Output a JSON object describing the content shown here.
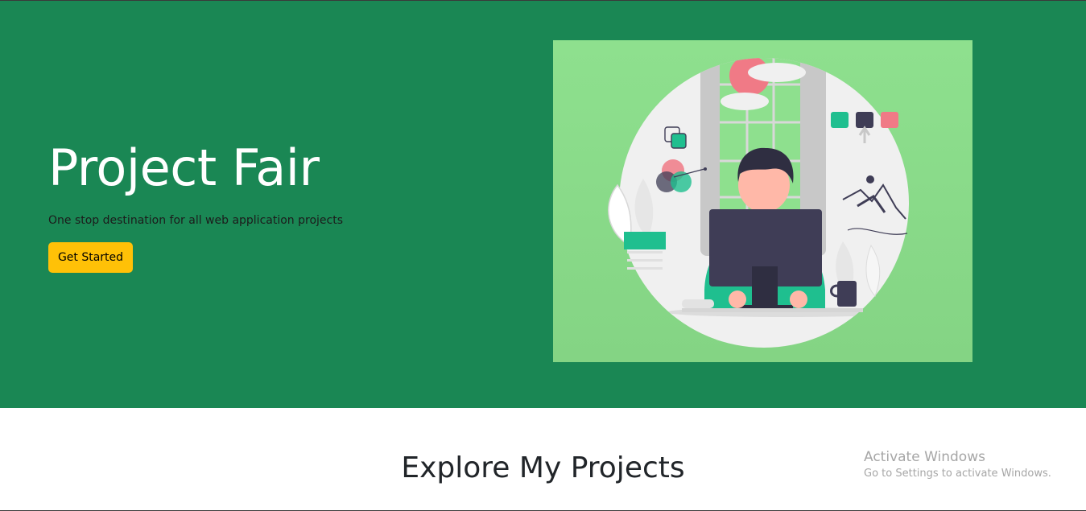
{
  "hero": {
    "title": "Project Fair",
    "subtitle": "One stop destination for all web application projects",
    "cta_label": "Get Started",
    "illustration_icon": "developer-at-desk-illustration"
  },
  "explore": {
    "heading": "Explore My Projects"
  },
  "os_watermark": {
    "title": "Activate Windows",
    "subtitle": "Go to Settings to activate Windows."
  },
  "colors": {
    "hero_background": "#1a8754",
    "button_background": "#ffc107",
    "illustration_background": "#8ee08e",
    "accent_teal": "#1fbf8f",
    "accent_pink": "#f07a86",
    "monitor_dark": "#3f3d56"
  }
}
